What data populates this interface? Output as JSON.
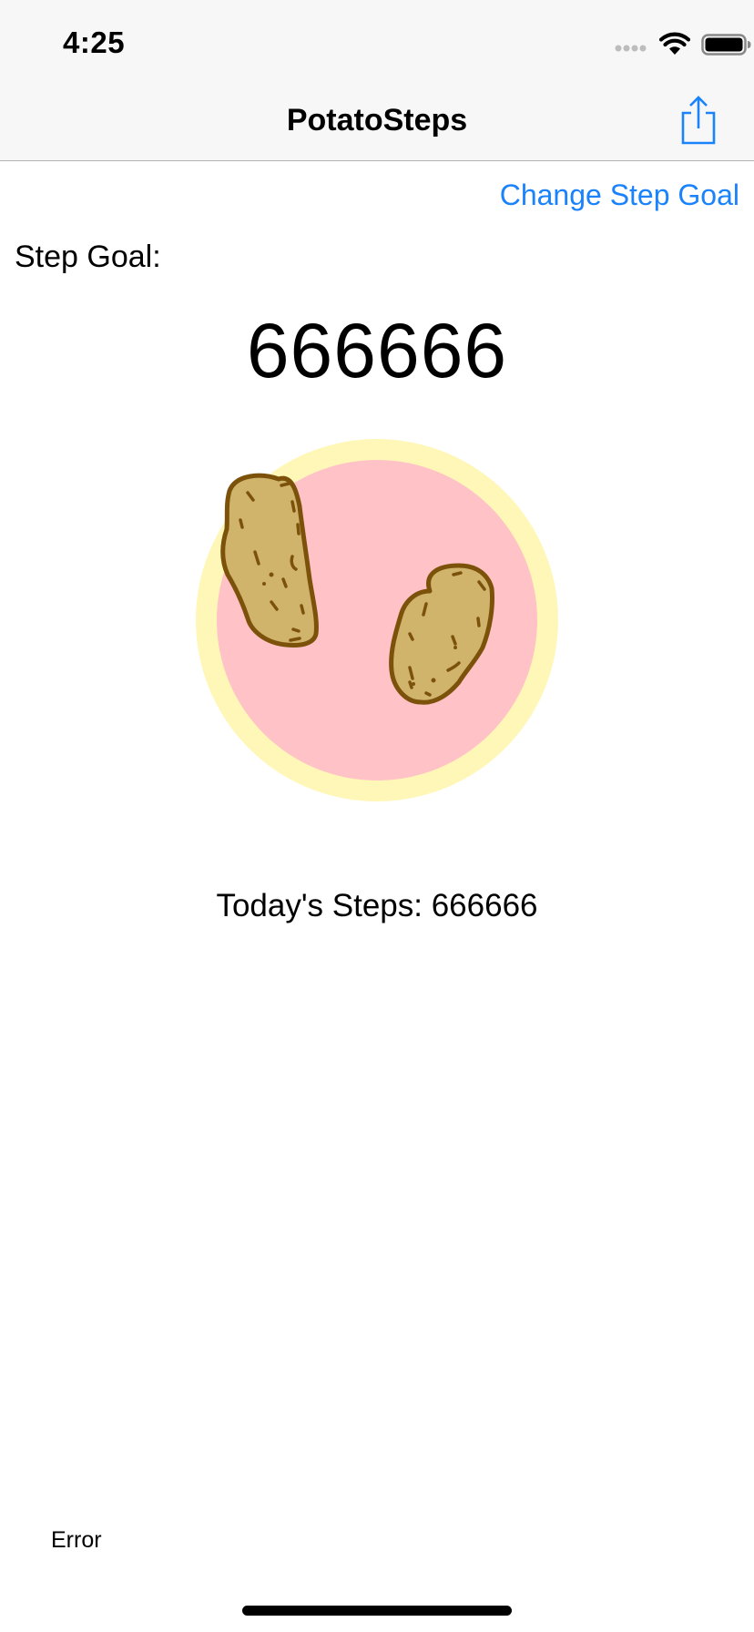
{
  "status_bar": {
    "time": "4:25",
    "icons": [
      "signal-icon",
      "wifi-icon",
      "battery-icon"
    ]
  },
  "nav": {
    "title": "PotatoSteps",
    "share_icon": "share-icon"
  },
  "change_goal_label": "Change Step Goal",
  "goal": {
    "label": "Step Goal:",
    "value": "666666"
  },
  "badge": {
    "icon": "potato-footprints-icon",
    "outer_color": "#fff7b8",
    "inner_color": "#ffc2c6",
    "potato_fill": "#d0b46c",
    "potato_stroke": "#7c520b"
  },
  "today_steps": "Today's Steps: 666666",
  "error_text": "Error",
  "colors": {
    "accent": "#1a82fb",
    "nav_background": "#f7f7f7"
  }
}
